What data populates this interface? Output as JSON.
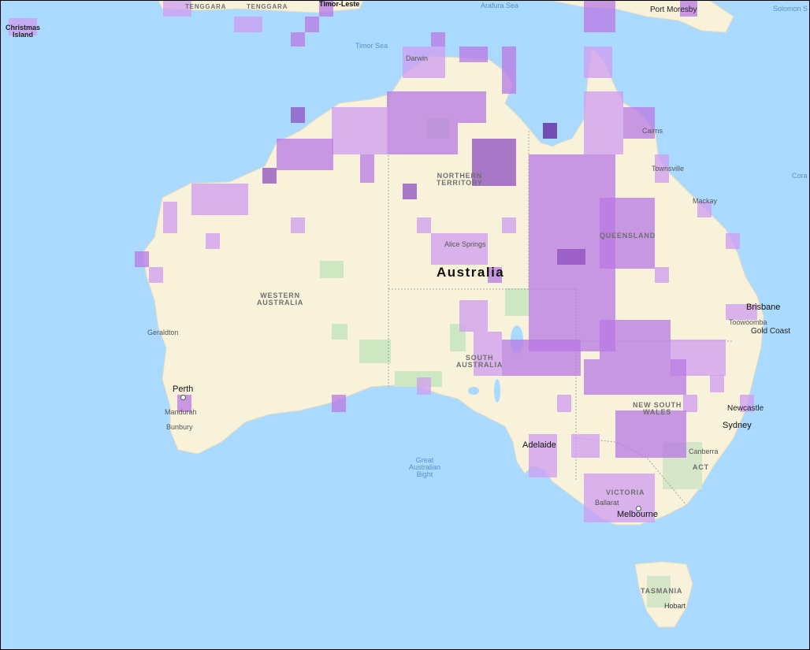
{
  "map": {
    "country_label": "Australia",
    "state_labels": {
      "western_australia": [
        "WESTERN",
        "AUSTRALIA"
      ],
      "northern_territory": [
        "NORTHERN",
        "TERRITORY"
      ],
      "queensland": "QUEENSLAND",
      "south_australia": [
        "SOUTH",
        "AUSTRALIA"
      ],
      "new_south_wales": [
        "NEW SOUTH",
        "WALES"
      ],
      "victoria": "VICTORIA",
      "tasmania": "TASMANIA",
      "act": "ACT"
    },
    "water_labels": {
      "arafura_sea": "Arafura Sea",
      "timor_sea": "Timor Sea",
      "great_australian_bight": [
        "Great",
        "Australian",
        "Bight"
      ],
      "coral": "Cora",
      "solomon": "Solomon S"
    },
    "region_labels": {
      "christmas_island": [
        "Christmas",
        "Island"
      ],
      "tenggara_1": "TENGGARA",
      "tenggara_2": "TENGGARA",
      "timor_leste": "Timor-Leste",
      "port_moresby": "Port Moresby"
    },
    "city_labels": {
      "darwin": "Darwin",
      "cairns": "Cairns",
      "townsville": "Townsville",
      "mackay": "Mackay",
      "alice_springs": "Alice Springs",
      "brisbane": "Brisbane",
      "toowoomba": "Toowoomba",
      "gold_coast": "Gold Coast",
      "geraldton": "Geraldton",
      "perth": "Perth",
      "mandurah": "Mandurah",
      "bunbury": "Bunbury",
      "newcastle": "Newcastle",
      "sydney": "Sydney",
      "canberra": "Canberra",
      "adelaide": "Adelaide",
      "ballarat": "Ballarat",
      "melbourne": "Melbourne",
      "hobart": "Hobart"
    },
    "colors": {
      "ocean": "#aadaff",
      "land": "#f8f2da",
      "parks": "#cde8c0",
      "cell_light": "#cf9cf0",
      "cell_mid": "#b878e4",
      "cell_dark": "#8e4fc0"
    }
  }
}
